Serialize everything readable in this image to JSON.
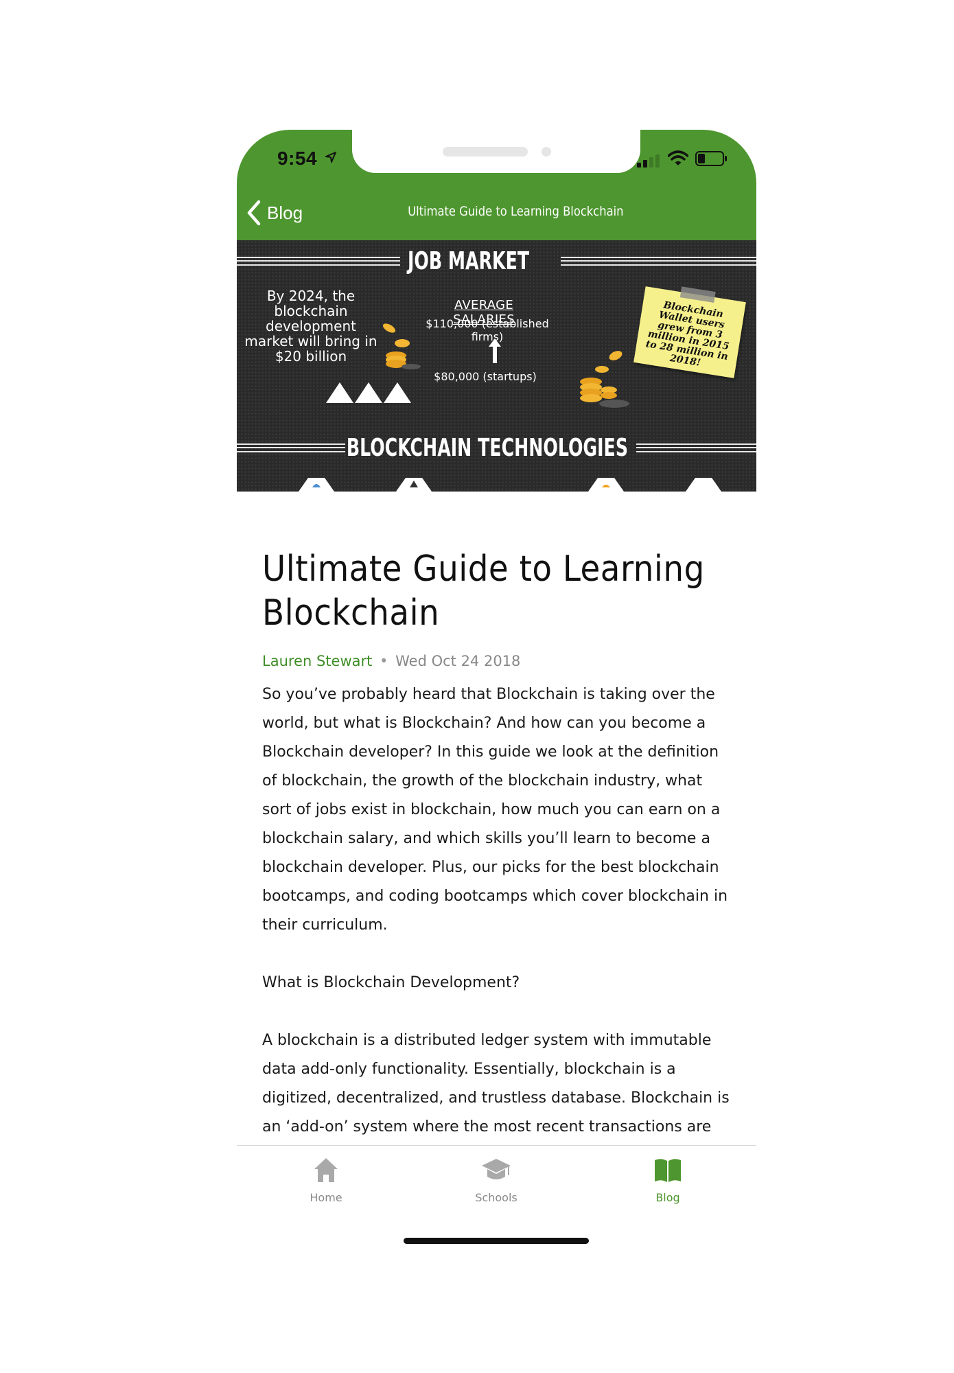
{
  "status_bar": {
    "time": "9:54"
  },
  "nav": {
    "back_label": "Blog",
    "title": "Ultimate Guide to Learning Blockchain"
  },
  "hero": {
    "heading_top": "JOB MARKET",
    "left_text": "By 2024, the blockchain development market will bring in $20 billion",
    "avg_label": "AVERAGE SALARIES",
    "salary_established": "$110,000 (established firms)",
    "salary_startups": "$80,000 (startups)",
    "sticky_text": "Blockchain Wallet users grew from 3 million in 2015 to 28 million in 2018!",
    "heading_bottom": "BLOCKCHAIN TECHNOLOGIES"
  },
  "article": {
    "title": "Ultimate Guide to Learning Blockchain",
    "author": "Lauren Stewart",
    "separator": "•",
    "date": "Wed Oct 24 2018",
    "paragraphs": [
      "So you’ve probably heard that Blockchain is taking over the world, but what is Blockchain? And how can you become a Blockchain developer? In this guide we look at the definition of blockchain, the growth of the blockchain industry, what sort of jobs exist in blockchain, how much you can earn on a blockchain salary, and which skills you’ll learn to become a blockchain developer. Plus, our picks for the best blockchain bootcamps, and coding bootcamps which cover blockchain in their curriculum.",
      "What is Blockchain Development?",
      "A blockchain is a distributed ledger system with immutable data add-only functionality. Essentially, blockchain is a digitized, decentralized, and trustless database. Blockchain is an ‘add-on’ system where the most recent transactions are"
    ]
  },
  "tabs": [
    {
      "label": "Home",
      "icon": "house-icon"
    },
    {
      "label": "Schools",
      "icon": "graduation-cap-icon"
    },
    {
      "label": "Blog",
      "icon": "open-book-icon",
      "active": true
    }
  ],
  "colors": {
    "brand_green": "#4e962f",
    "author_green": "#3e8e25"
  }
}
